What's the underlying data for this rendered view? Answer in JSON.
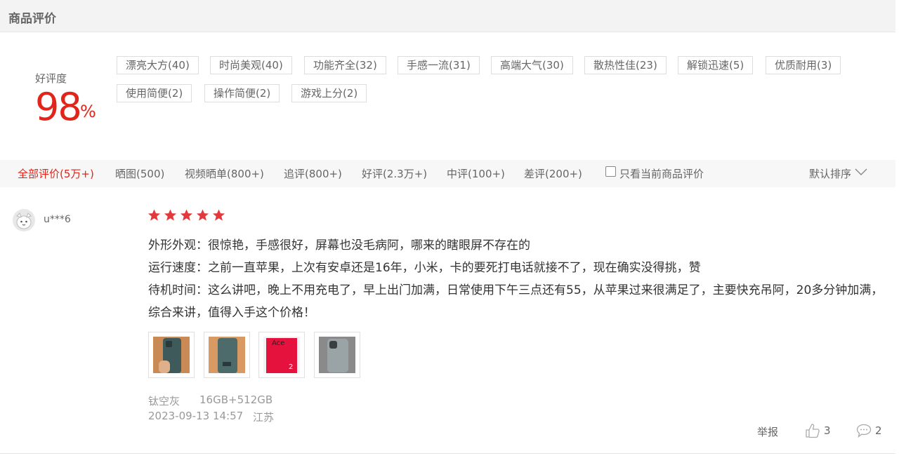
{
  "header": {
    "title": "商品评价"
  },
  "score": {
    "label": "好评度",
    "value": "98",
    "unit": "%"
  },
  "tags": [
    {
      "label": "漂亮大方(40)"
    },
    {
      "label": "时尚美观(40)"
    },
    {
      "label": "功能齐全(32)"
    },
    {
      "label": "手感一流(31)"
    },
    {
      "label": "高端大气(30)"
    },
    {
      "label": "散热性佳(23)"
    },
    {
      "label": "解锁迅速(5)"
    },
    {
      "label": "优质耐用(3)"
    },
    {
      "label": "使用简便(2)"
    },
    {
      "label": "操作简便(2)"
    },
    {
      "label": "游戏上分(2)"
    }
  ],
  "filters": {
    "items": [
      {
        "label": "全部评价(5万+)"
      },
      {
        "label": "晒图(500)"
      },
      {
        "label": "视频晒单(800+)"
      },
      {
        "label": "追评(800+)"
      },
      {
        "label": "好评(2.3万+)"
      },
      {
        "label": "中评(100+)"
      },
      {
        "label": "差评(200+)"
      }
    ],
    "checkbox_label": "只看当前商品评价",
    "checkbox_checked": false,
    "sort_label": "默认排序"
  },
  "review": {
    "username": "u***6",
    "stars": 5,
    "lines": [
      "外形外观：很惊艳，手感很好，屏幕也没毛病阿，哪来的瞎眼屏不存在的",
      "运行速度：之前一直苹果，上次有安卓还是16年，小米，卡的要死打电话就接不了，现在确实没得挑，赞",
      "待机时间：这么讲吧，晚上不用充电了，早上出门加满，日常使用下午三点还有55，从苹果过来很满足了，主要快充吊阿，20多分钟加满，综合来讲，值得入手这个价格！"
    ],
    "photo_box_text": "Ace",
    "photo_box_number": "2",
    "color": "钛空灰",
    "spec": "16GB+512GB",
    "datetime": "2023-09-13 14:57",
    "location": "江苏",
    "report_label": "举报",
    "like_count": "3",
    "comment_count": "2"
  },
  "colors": {
    "accent": "#e1251b",
    "star": "#e4393c",
    "muted": "#999999"
  }
}
